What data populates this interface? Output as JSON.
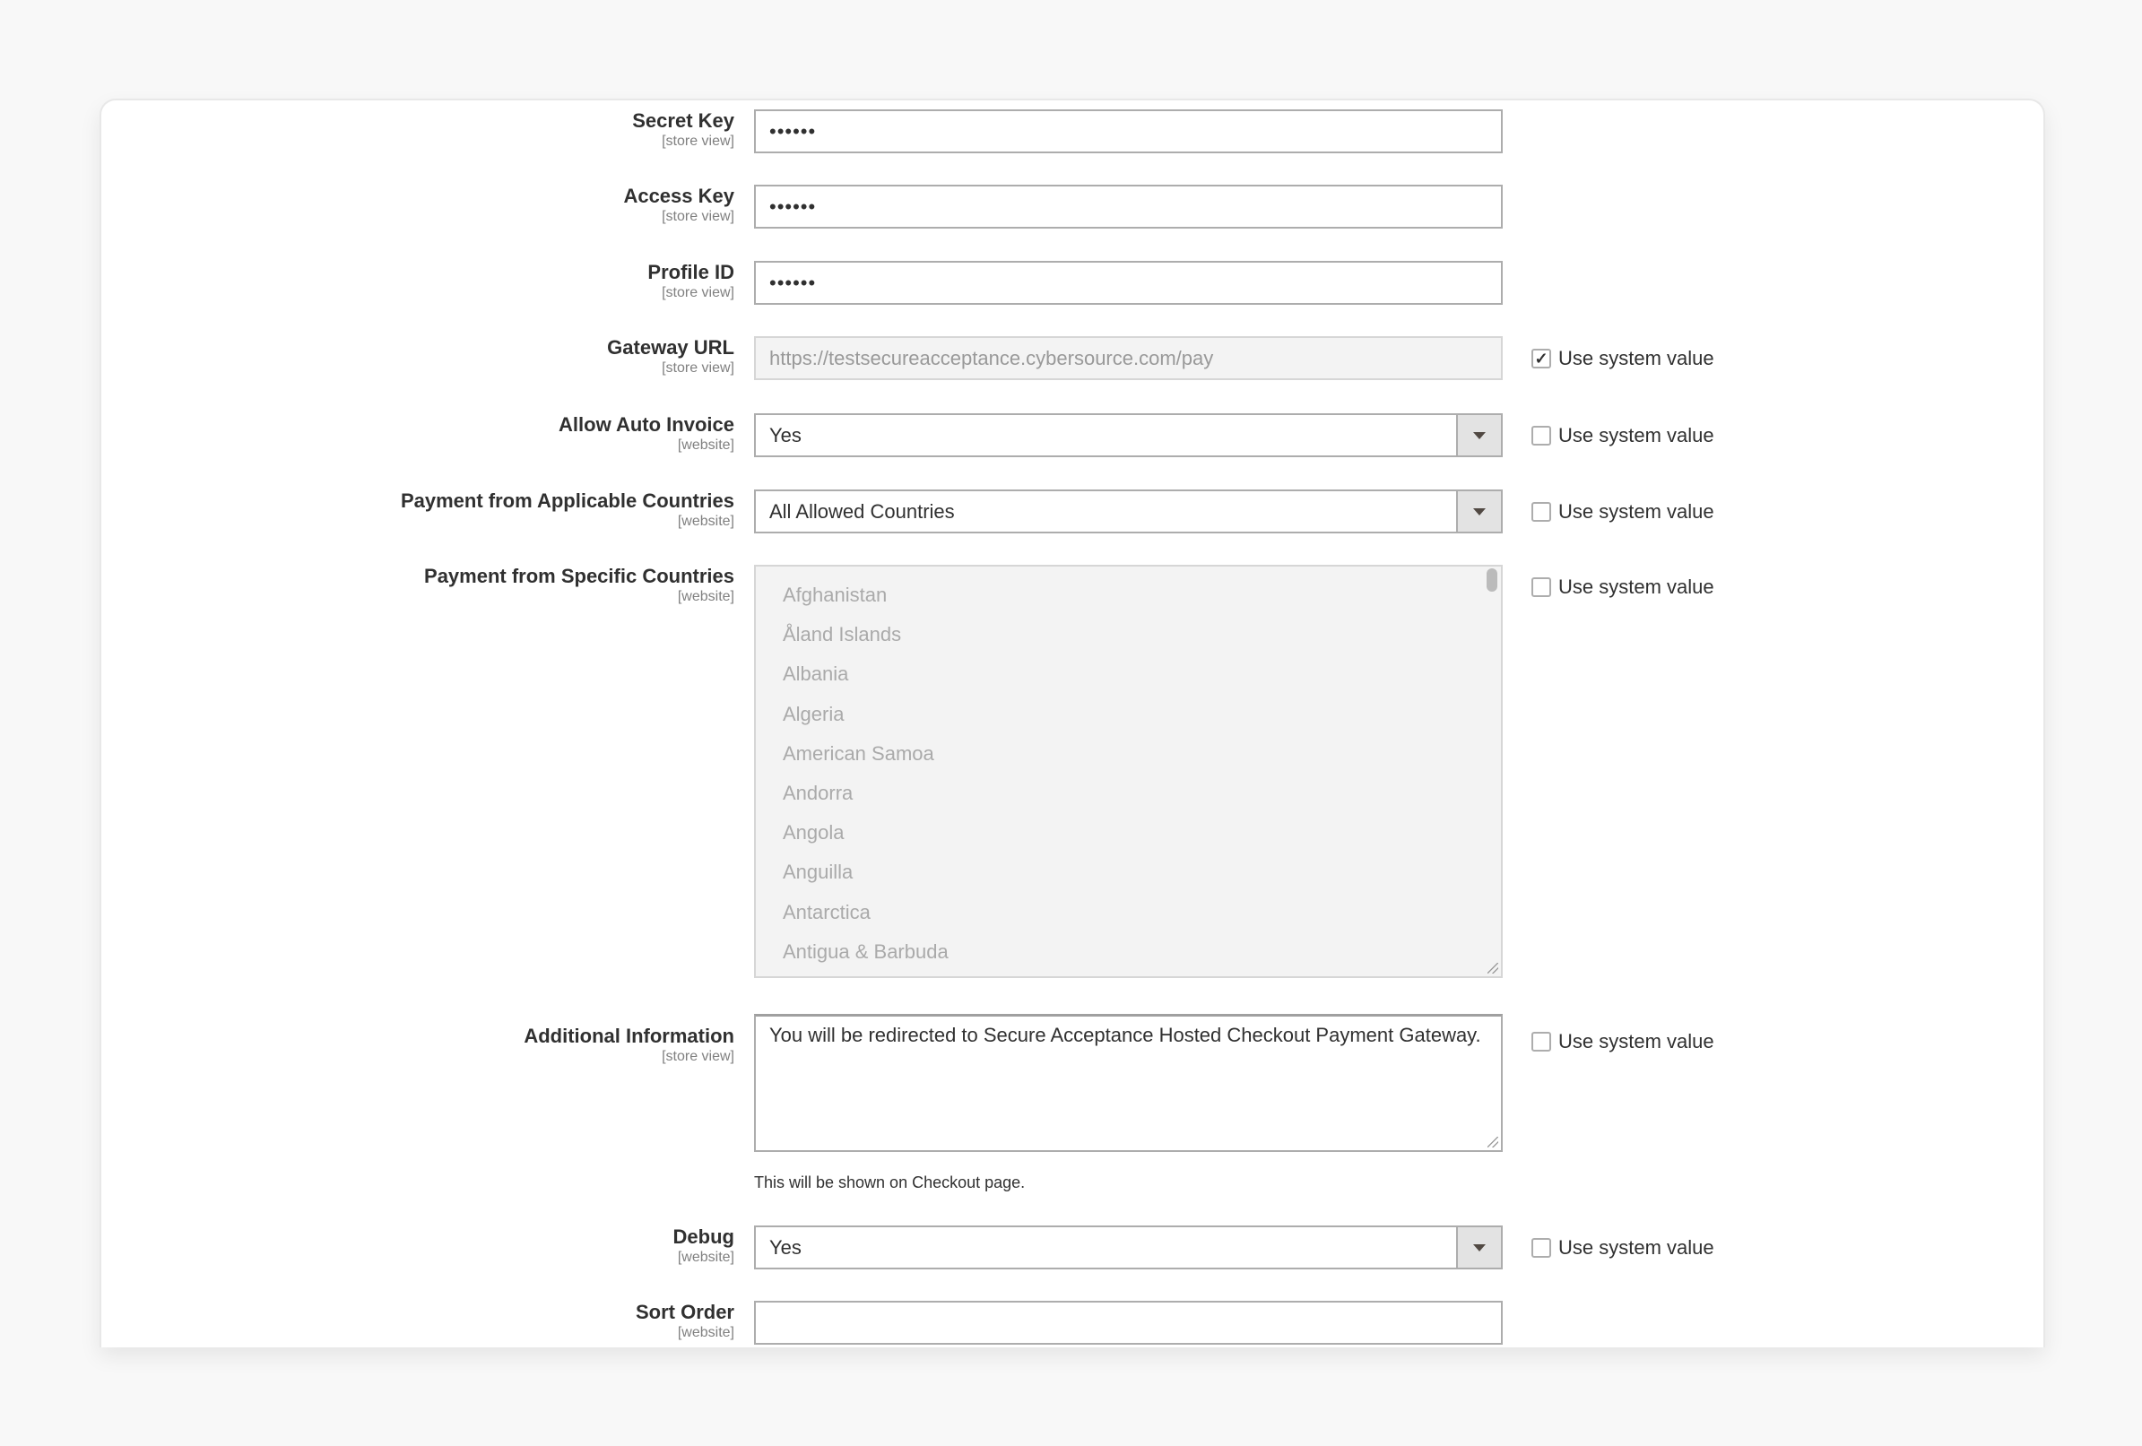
{
  "use_system_value_label": "Use system value",
  "fields": {
    "secret_key": {
      "label": "Secret Key",
      "scope": "[store view]",
      "value": "••••••"
    },
    "access_key": {
      "label": "Access Key",
      "scope": "[store view]",
      "value": "••••••"
    },
    "profile_id": {
      "label": "Profile ID",
      "scope": "[store view]",
      "value": "••••••"
    },
    "gateway_url": {
      "label": "Gateway URL",
      "scope": "[store view]",
      "value": "https://testsecureacceptance.cybersource.com/pay",
      "use_system_value": true
    },
    "allow_auto_invoice": {
      "label": "Allow Auto Invoice",
      "scope": "[website]",
      "value": "Yes",
      "use_system_value": false
    },
    "applicable_countries": {
      "label": "Payment from Applicable Countries",
      "scope": "[website]",
      "value": "All Allowed Countries",
      "use_system_value": false
    },
    "specific_countries": {
      "label": "Payment from Specific Countries",
      "scope": "[website]",
      "use_system_value": false,
      "options": [
        "Afghanistan",
        "Åland Islands",
        "Albania",
        "Algeria",
        "American Samoa",
        "Andorra",
        "Angola",
        "Anguilla",
        "Antarctica",
        "Antigua & Barbuda"
      ]
    },
    "additional_information": {
      "label": "Additional Information",
      "scope": "[store view]",
      "value": "You will be redirected to Secure Acceptance Hosted Checkout Payment Gateway.",
      "note": "This will be shown on Checkout page.",
      "use_system_value": false
    },
    "debug": {
      "label": "Debug",
      "scope": "[website]",
      "value": "Yes",
      "use_system_value": false
    },
    "sort_order": {
      "label": "Sort Order",
      "scope": "[website]",
      "value": ""
    }
  }
}
